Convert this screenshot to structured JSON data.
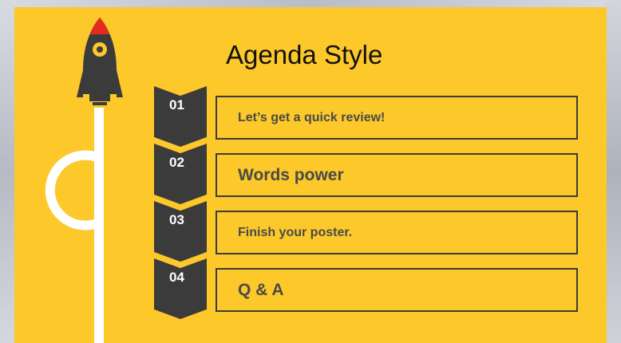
{
  "slide": {
    "title": "Agenda Style"
  },
  "agenda": [
    {
      "number": "01",
      "text": "Let’s get a quick review!"
    },
    {
      "number": "02",
      "text": "Words power"
    },
    {
      "number": "03",
      "text": "Finish your poster."
    },
    {
      "number": "04",
      "text": "Q & A"
    }
  ],
  "colors": {
    "background": "#fcc82a",
    "dark": "#3b3b3b",
    "text": "#4b4a48",
    "rocket_tip": "#e32b1f",
    "trail": "#ffffff"
  },
  "icons": [
    "rocket-icon",
    "rocket-trail"
  ]
}
